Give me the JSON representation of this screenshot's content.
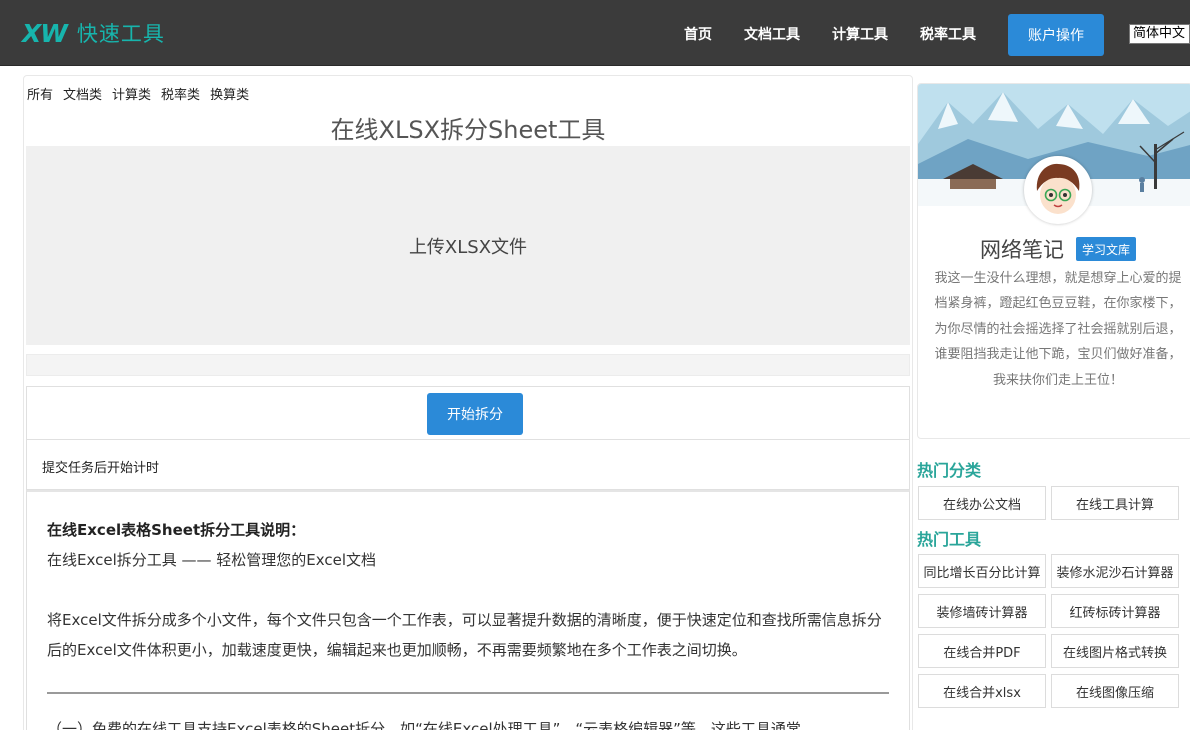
{
  "header": {
    "logo_mark": "XW",
    "logo_text": "快速工具",
    "nav": [
      "首页",
      "文档工具",
      "计算工具",
      "税率工具"
    ],
    "account_button": "账户操作",
    "language": "简体中文"
  },
  "main": {
    "categories": [
      "所有",
      "文档类",
      "计算类",
      "税率类",
      "换算类"
    ],
    "title": "在线XLSX拆分Sheet工具",
    "upload_label": "上传XLSX文件",
    "start_button": "开始拆分",
    "status_text": "提交任务后开始计时",
    "description": {
      "heading": "在线Excel表格Sheet拆分工具说明：",
      "subheading": "在线Excel拆分工具 —— 轻松管理您的Excel文档",
      "paragraph": "将Excel文件拆分成多个小文件，每个文件只包含一个工作表，可以显著提升数据的清晰度，便于快速定位和查找所需信息拆分后的Excel文件体积更小，加载速度更快，编辑起来也更加顺畅，不再需要频繁地在多个工作表之间切换。",
      "next_line": "（一）免费的在线工具支持Excel表格的Sheet拆分，如“在线Excel处理工具”、“云表格编辑器”等，这些工具通常"
    }
  },
  "sidebar": {
    "profile": {
      "name": "网络笔记",
      "badge": "学习文库",
      "bio": "我这一生没什么理想，就是想穿上心爱的提档紧身裤，蹬起红色豆豆鞋，在你家楼下，为你尽情的社会摇选择了社会摇就别后退，谁要阻挡我走让他下跪，宝贝们做好准备，我来扶你们走上王位！"
    },
    "hot_categories_title": "热门分类",
    "hot_categories": [
      "在线办公文档",
      "在线工具计算"
    ],
    "hot_tools_title": "热门工具",
    "hot_tools": [
      "同比增长百分比计算",
      "装修水泥沙石计算器",
      "装修墙砖计算器",
      "红砖标砖计算器",
      "在线合并PDF",
      "在线图片格式转换",
      "在线合并xlsx",
      "在线图像压缩"
    ]
  },
  "colors": {
    "header_bg": "#3b3b3b",
    "brand_teal": "#17b5ad",
    "accent_blue": "#2b8ad8",
    "section_green": "#2aa59a"
  }
}
